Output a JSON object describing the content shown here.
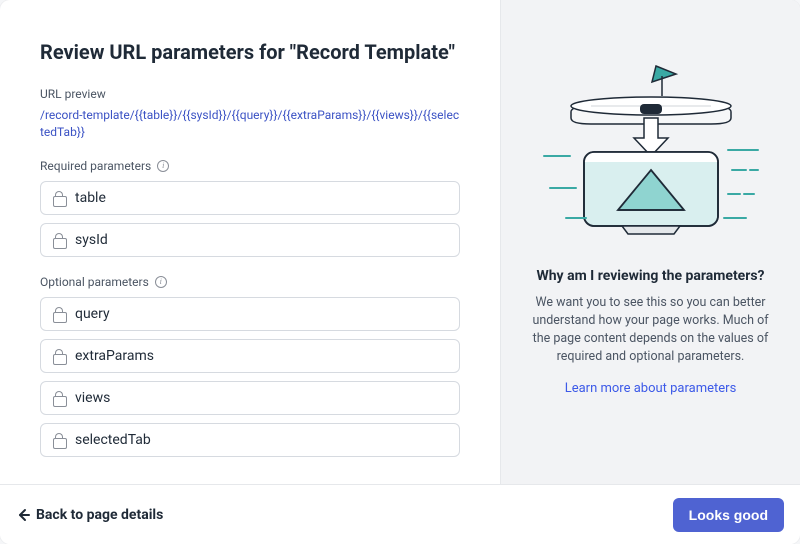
{
  "header": {
    "title": "Review URL parameters for \"Record Template\""
  },
  "urlPreview": {
    "label": "URL preview",
    "value": "/record-template/{{table}}/{{sysId}}/{{query}}/{{extraParams}}/{{views}}/{{selectedTab}}"
  },
  "required": {
    "label": "Required parameters",
    "items": [
      "table",
      "sysId"
    ]
  },
  "optional": {
    "label": "Optional parameters",
    "items": [
      "query",
      "extraParams",
      "views",
      "selectedTab"
    ]
  },
  "sidebar": {
    "heading": "Why am I reviewing the parameters?",
    "body": "We want you to see this so you can better understand how your page works. Much of the page content depends on the values of required and optional parameters.",
    "linkText": "Learn more about parameters"
  },
  "footer": {
    "back": "Back to page details",
    "primary": "Looks good"
  }
}
